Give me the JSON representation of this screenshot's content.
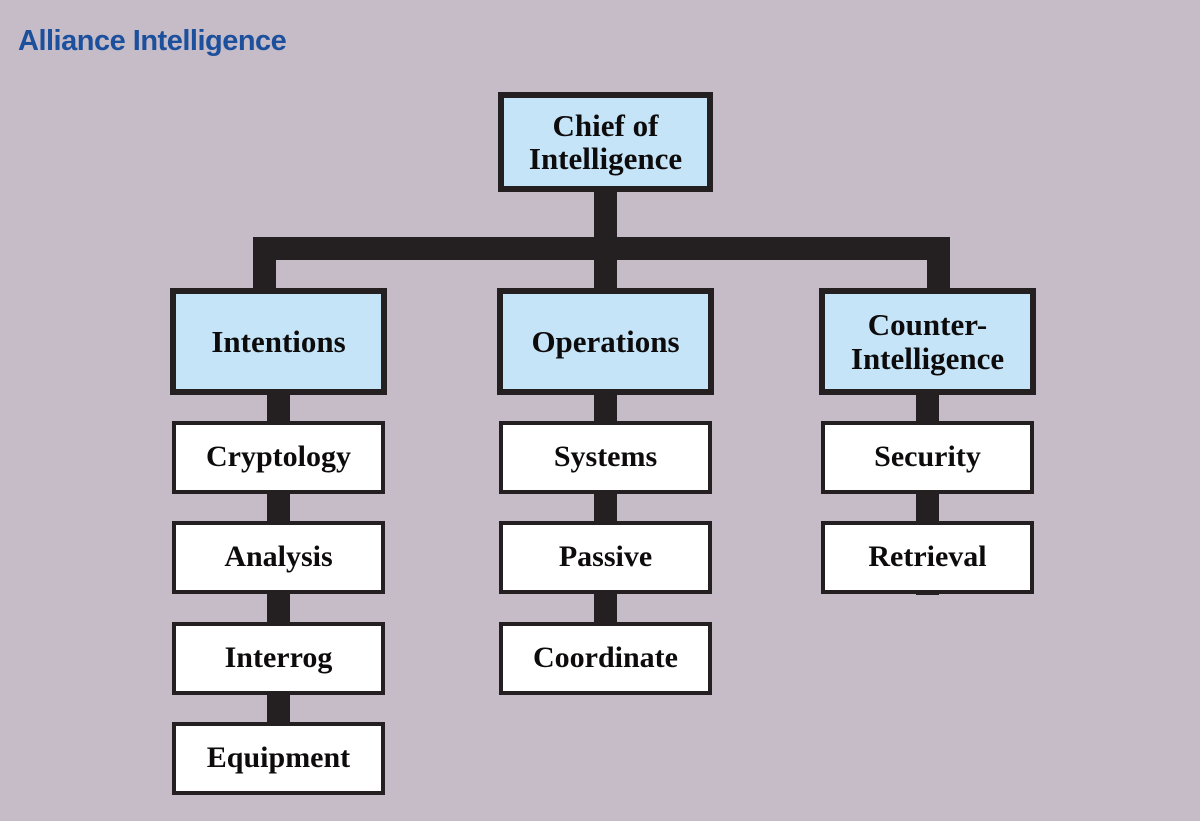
{
  "title": "Alliance Intelligence",
  "colors": {
    "background": "#c6bcc8",
    "title_blue": "#1c4f9c",
    "node_blue_fill": "#c5e4f7",
    "node_white_fill": "#ffffff",
    "line_black": "#241f20"
  },
  "chart_data": {
    "type": "diagram",
    "diagram_type": "organizational-chart",
    "title": "Alliance Intelligence",
    "root": "Chief of Intelligence",
    "branches": [
      {
        "head": "Intentions",
        "children": [
          "Cryptology",
          "Analysis",
          "Interrog",
          "Equipment"
        ]
      },
      {
        "head": "Operations",
        "children": [
          "Systems",
          "Passive",
          "Coordinate"
        ]
      },
      {
        "head": "Counter-Intelligence",
        "children": [
          "Security",
          "Retrieval"
        ]
      }
    ]
  },
  "nodes": {
    "root": {
      "label_line1": "Chief of",
      "label_line2": "Intelligence"
    },
    "branch1": {
      "head": "Intentions",
      "c1": "Cryptology",
      "c2": "Analysis",
      "c3": "Interrog",
      "c4": "Equipment"
    },
    "branch2": {
      "head": "Operations",
      "c1": "Systems",
      "c2": "Passive",
      "c3": "Coordinate"
    },
    "branch3": {
      "head_line1": "Counter-",
      "head_line2": "Intelligence",
      "c1": "Security",
      "c2": "Retrieval"
    }
  }
}
